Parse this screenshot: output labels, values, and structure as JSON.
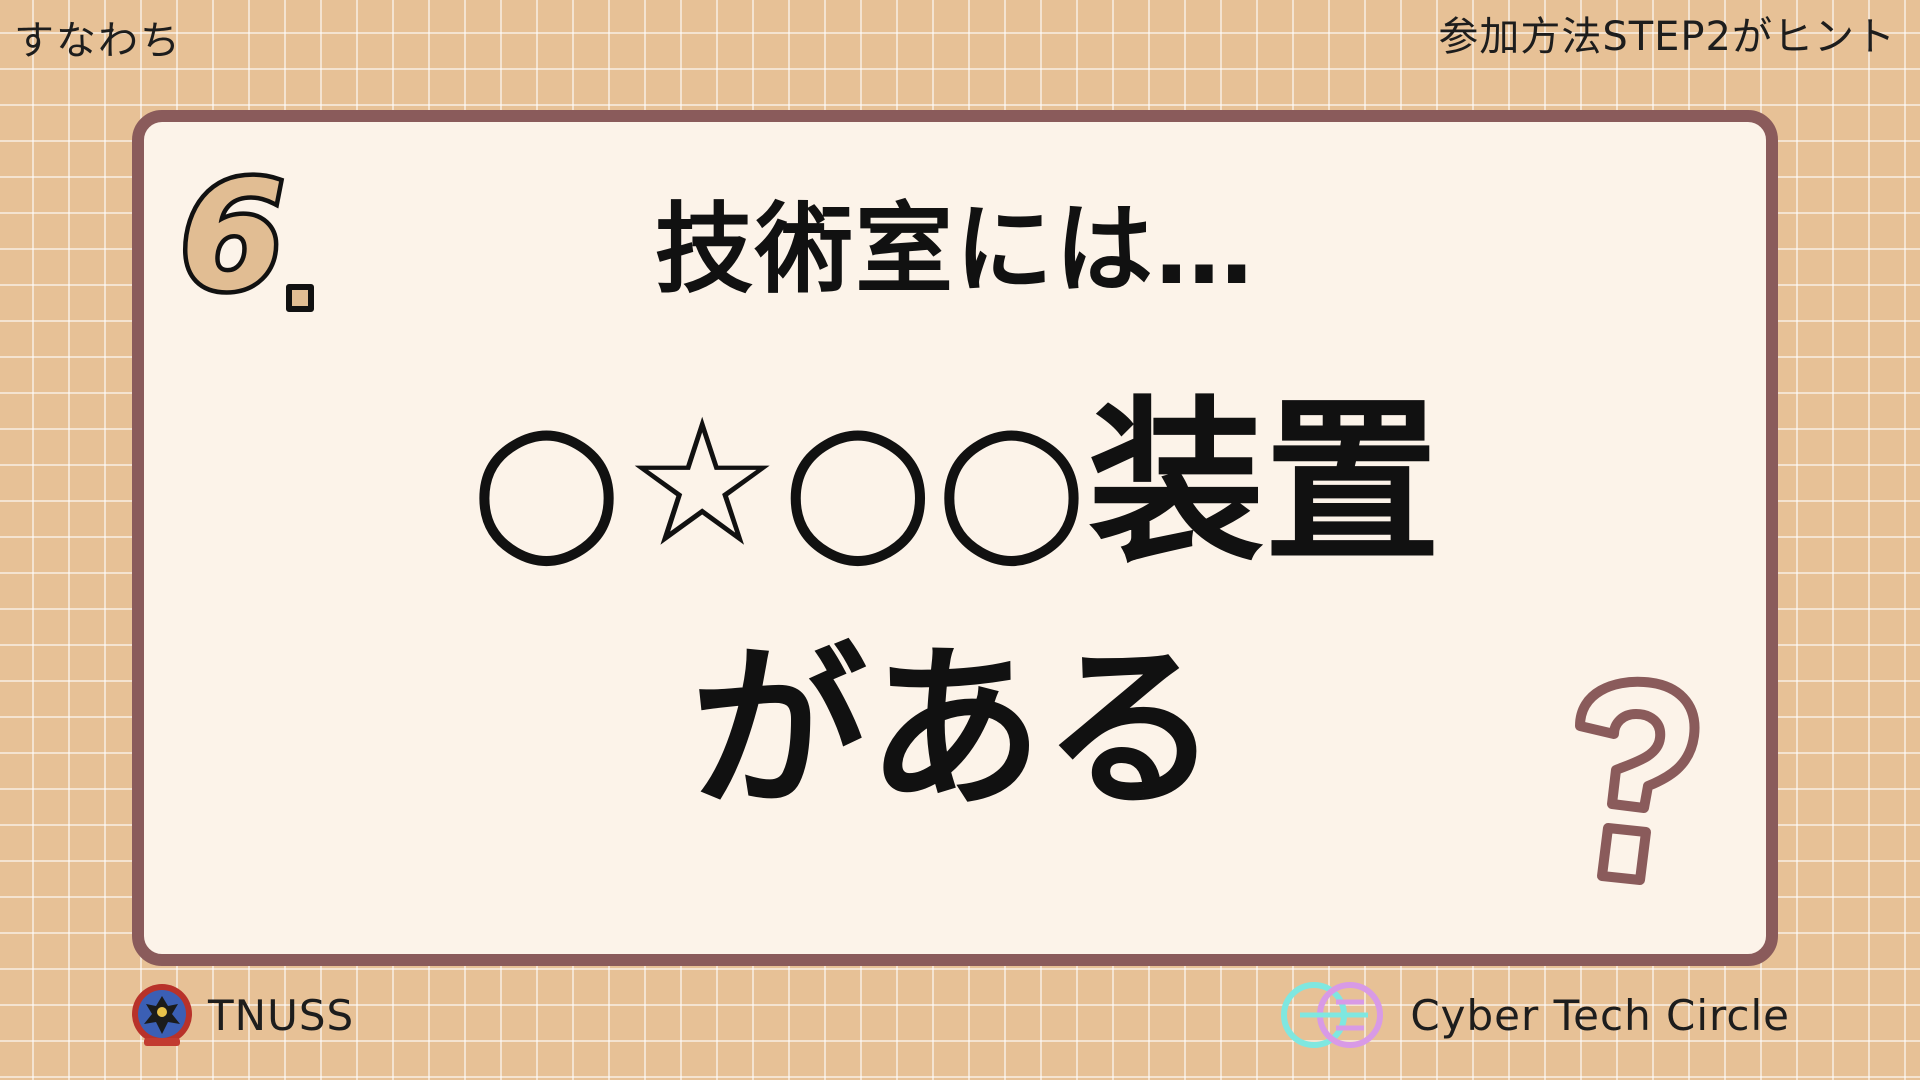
{
  "corner": {
    "left_text": "すなわち",
    "right_text": "参加方法STEP2がヒント"
  },
  "question": {
    "number": "6",
    "headline": "技術室には…",
    "answer_blanks": "○☆○○",
    "answer_word": "装置",
    "answer_line2": "がある"
  },
  "footer": {
    "left_org": "TNUSS",
    "right_org": "Cyber Tech Circle"
  },
  "colors": {
    "background": "#e7c196",
    "card": "#fcf3e9",
    "card_border": "#8a5b5b",
    "accent_tan": "#e1bd93",
    "logo_cyan": "#7fe7e0",
    "logo_pink": "#d89ae6"
  },
  "icons": {
    "question_mark": "question-mark-icon",
    "tnuss_logo": "eagle-crest-icon",
    "cyber_logo": "circle-logo-icon"
  }
}
